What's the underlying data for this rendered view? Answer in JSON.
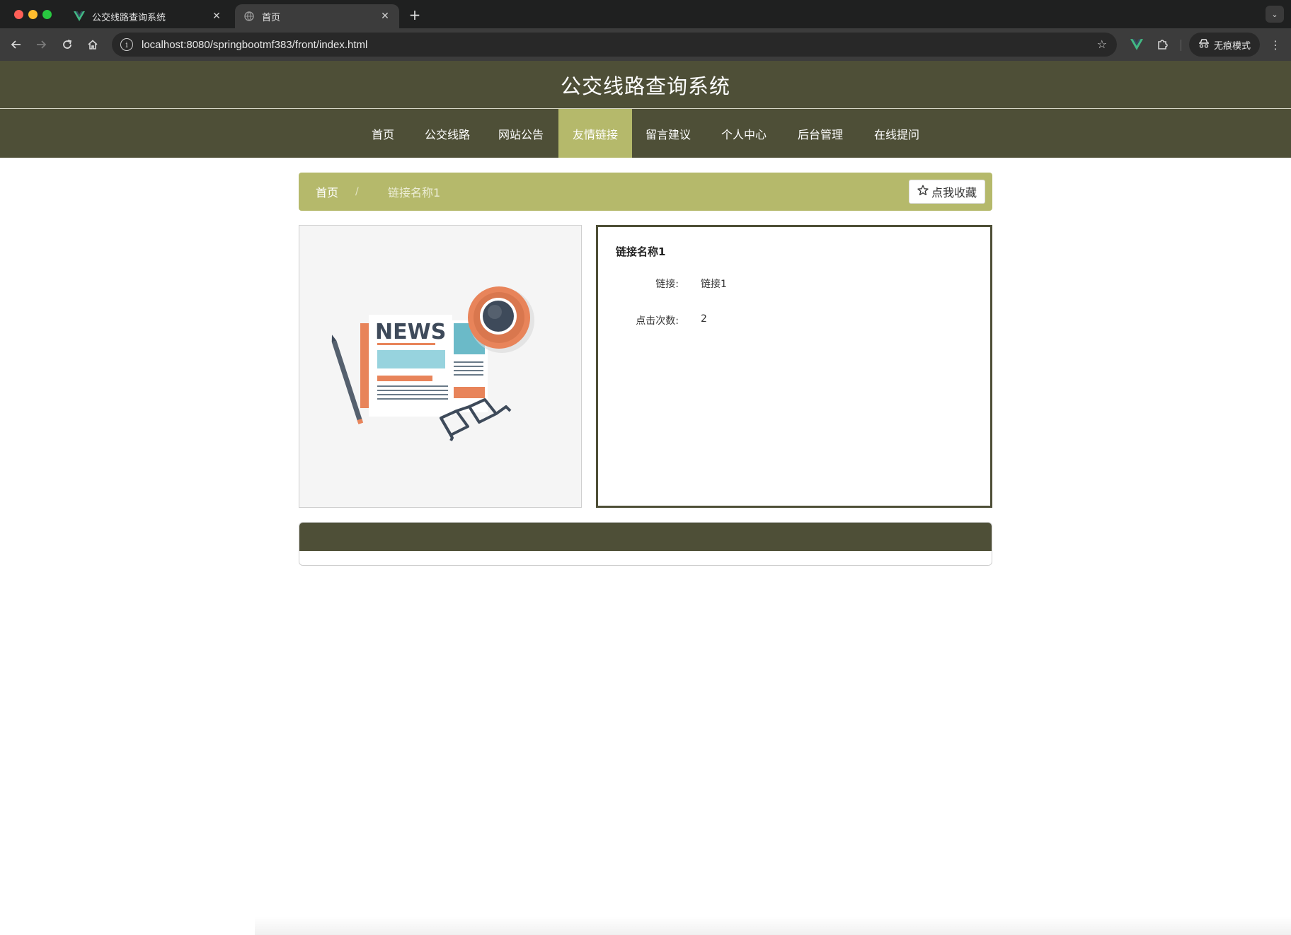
{
  "browser": {
    "tabs": [
      {
        "title": "公交线路查询系统",
        "active": false
      },
      {
        "title": "首页",
        "active": true
      }
    ],
    "url": "localhost:8080/springbootmf383/front/index.html",
    "incognito_label": "无痕模式"
  },
  "site": {
    "title": "公交线路查询系统",
    "nav": [
      {
        "label": "首页",
        "active": false
      },
      {
        "label": "公交线路",
        "active": false
      },
      {
        "label": "网站公告",
        "active": false
      },
      {
        "label": "友情链接",
        "active": true
      },
      {
        "label": "留言建议",
        "active": false
      },
      {
        "label": "个人中心",
        "active": false
      },
      {
        "label": "后台管理",
        "active": false
      },
      {
        "label": "在线提问",
        "active": false
      }
    ],
    "accent_color": "#b5b96b",
    "header_color": "#4e4f37"
  },
  "breadcrumb": {
    "home": "首页",
    "separator": "/",
    "current": "链接名称1"
  },
  "favorite_button": {
    "label": "点我收藏",
    "icon": "star-outline-icon"
  },
  "image": {
    "text": "NEWS"
  },
  "detail": {
    "title": "链接名称1",
    "fields": [
      {
        "label": "链接:",
        "value": "链接1"
      },
      {
        "label": "点击次数:",
        "value": "2"
      }
    ]
  }
}
